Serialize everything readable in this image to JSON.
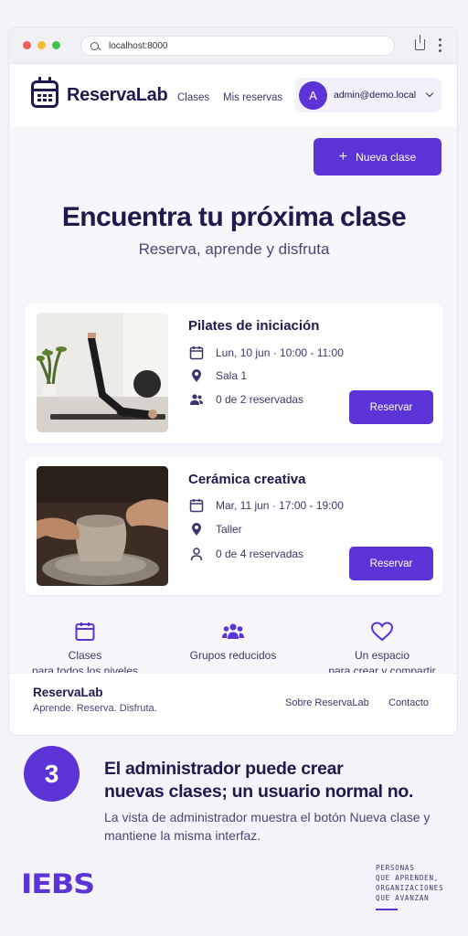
{
  "browser": {
    "url": "localhost:8000"
  },
  "nav": {
    "brand": "ReservaLab",
    "links": [
      "Clases",
      "Mis reservas"
    ],
    "user": {
      "initial": "A",
      "email": "admin@demo.local"
    }
  },
  "main": {
    "new_class_label": "Nueva clase",
    "hero_title": "Encuentra tu próxima clase",
    "hero_subtitle": "Reserva, aprende y disfruta",
    "classes": [
      {
        "title": "Pilates de iniciación",
        "schedule": "Lun, 10 jun · 10:00 - 11:00",
        "location": "Sala 1",
        "capacity": "0 de 2 reservadas",
        "button": "Reservar"
      },
      {
        "title": "Cerámica creativa",
        "schedule": "Mar, 11 jun · 17:00 - 19:00",
        "location": "Taller",
        "capacity": "0 de 4 reservadas",
        "button": "Reservar"
      }
    ],
    "features": [
      {
        "icon": "calendar-icon",
        "line1": "Clases",
        "line2": "para todos los niveles"
      },
      {
        "icon": "group-icon",
        "line1": "Grupos reducidos",
        "line2": ""
      },
      {
        "icon": "heart-icon",
        "line1": "Un espacio",
        "line2": "para crear y compartir"
      }
    ]
  },
  "footer": {
    "brand": "ReservaLab",
    "tagline": "Aprende. Reserva. Disfruta.",
    "links": [
      "Sobre ReservaLab",
      "Contacto"
    ]
  },
  "caption": {
    "step": "3",
    "title_line1": "El administrador puede crear",
    "title_line2": "nuevas clases; un usuario normal no.",
    "body": "La vista de administrador muestra el botón Nueva clase y mantiene la misma interfaz."
  },
  "branding": {
    "logo": "IEBS",
    "tagline": [
      "PERSONAS",
      "QUE APRENDEN,",
      "ORGANIZACIONES",
      "QUE AVANZAN"
    ]
  },
  "colors": {
    "accent": "#5b33d6",
    "text": "#1e1a4d"
  }
}
